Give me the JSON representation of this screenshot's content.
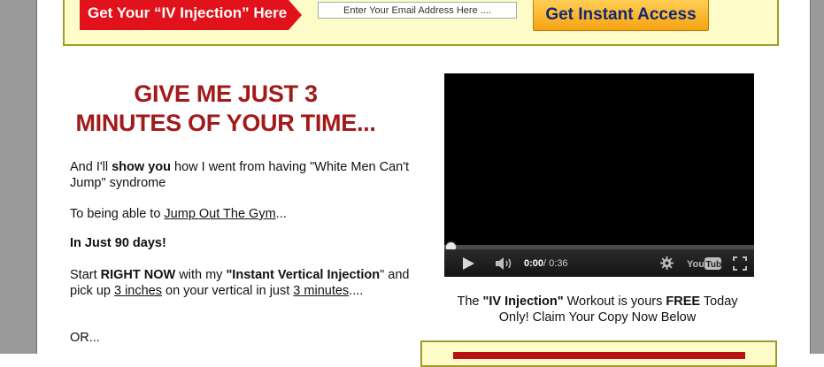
{
  "optin": {
    "ribbon_label": "Get Your “IV Injection” Here",
    "email_placeholder": "Enter Your Email Address Here ....",
    "button_label": "Get Instant Access"
  },
  "headline": {
    "line1": "GIVE ME JUST 3",
    "line2": "MINUTES OF YOUR TIME..."
  },
  "copy": {
    "p1_a": "And I'll ",
    "p1_bold": "show you",
    "p1_b": " how I went from having \"White Men Can't Jump\" syndrome",
    "p2_a": "To being able to ",
    "p2_link": "Jump Out The Gym",
    "p2_b": "...",
    "p3": "In Just 90 days!",
    "p4_a": "Start ",
    "p4_bold1": "RIGHT NOW",
    "p4_b": " with my ",
    "p4_bold2": "\"Instant Vertical Injection",
    "p4_c": "\" and pick up ",
    "p4_link1": "3 inches",
    "p4_d": " on your vertical in just ",
    "p4_link2": "3 minutes",
    "p4_e": "....",
    "p5": "OR..."
  },
  "video": {
    "current_time": "0:00",
    "duration": " / 0:36",
    "progress_fraction": 0.0
  },
  "caption": {
    "a": "The ",
    "bold1": "\"IV Injection\"",
    "b": " Workout is yours ",
    "bold2": "FREE",
    "c": " Today Only! Claim Your Copy Now Below"
  },
  "icons": {
    "play": "play-icon",
    "volume": "volume-icon",
    "settings": "gear-icon",
    "youtube": "youtube-logo",
    "fullscreen": "fullscreen-icon"
  },
  "colors": {
    "ribbon": "#e1121b",
    "headline": "#a31a1a",
    "optin_bg": "#fdfcc9",
    "button_text": "#142870"
  }
}
